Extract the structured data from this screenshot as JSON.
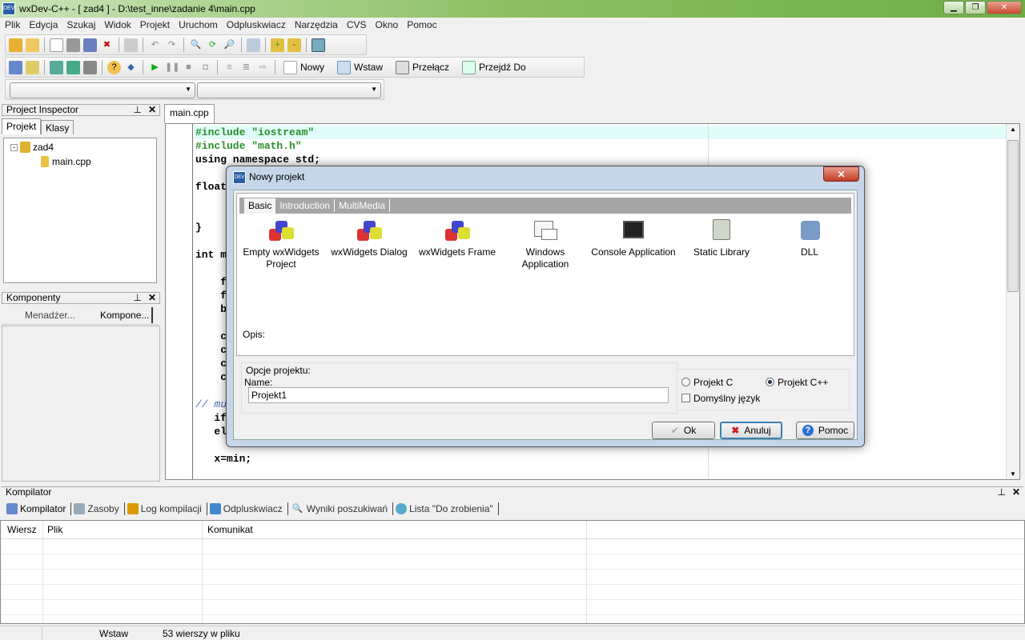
{
  "window": {
    "title": "wxDev-C++  - [ zad4 ] - D:\\test_inne\\zadanie 4\\main.cpp",
    "minimize": "▁",
    "maximize": "❐",
    "close": "✕",
    "logo": "DEV"
  },
  "menu": [
    "Plik",
    "Edycja",
    "Szukaj",
    "Widok",
    "Projekt",
    "Uruchom",
    "Odpluskwiacz",
    "Narzędzia",
    "CVS",
    "Okno",
    "Pomoc"
  ],
  "toolbar2": {
    "new": "Nowy",
    "insert": "Wstaw",
    "toggle": "Przełącz",
    "goto": "Przejdź Do"
  },
  "project_inspector": {
    "title": "Project Inspector",
    "tabs": [
      "Projekt",
      "Klasy"
    ],
    "tree": {
      "root": "zad4",
      "child": "main.cpp"
    }
  },
  "components": {
    "title": "Komponenty",
    "tabs": [
      "Menadżer...",
      "Kompone..."
    ]
  },
  "editor": {
    "tab": "main.cpp",
    "lines": [
      {
        "t": "#include \"iostream\"",
        "c": "pp"
      },
      {
        "t": "#include \"math.h\"",
        "c": "pp"
      },
      {
        "t": "using namespace std;",
        "c": ""
      },
      {
        "t": "",
        "c": ""
      },
      {
        "t": "float",
        "c": ""
      },
      {
        "t": "",
        "c": ""
      },
      {
        "t": "",
        "c": ""
      },
      {
        "t": "}",
        "c": ""
      },
      {
        "t": "",
        "c": ""
      },
      {
        "t": "int m",
        "c": ""
      },
      {
        "t": "",
        "c": ""
      },
      {
        "t": "    f",
        "c": ""
      },
      {
        "t": "    f",
        "c": ""
      },
      {
        "t": "    b",
        "c": ""
      },
      {
        "t": "",
        "c": ""
      },
      {
        "t": "    c",
        "c": ""
      },
      {
        "t": "    c",
        "c": ""
      },
      {
        "t": "    c",
        "c": ""
      },
      {
        "t": "    c",
        "c": ""
      },
      {
        "t": "",
        "c": ""
      },
      {
        "t": "// mu",
        "c": "cm"
      },
      {
        "t": "   if",
        "c": ""
      },
      {
        "t": "   el",
        "c": ""
      },
      {
        "t": "",
        "c": ""
      },
      {
        "t": "   x=min;",
        "c": ""
      }
    ]
  },
  "dialog": {
    "title": "Nowy projekt",
    "close": "✕",
    "tabs": [
      "Basic",
      "Introduction",
      "MultiMedia"
    ],
    "templates": [
      "Empty wxWidgets Project",
      "wxWidgets Dialog",
      "wxWidgets Frame",
      "Windows Application",
      "Console Application",
      "Static Library",
      "DLL"
    ],
    "description_label": "Opis:",
    "options_label": "Opcje projektu:",
    "name_label": "Name:",
    "name_value": "Projekt1",
    "radio_c": "Projekt C",
    "radio_cpp": "Projekt C++",
    "selected_language": "Projekt C++",
    "default_lang": "Domyślny język",
    "default_lang_checked": false,
    "ok": "Ok",
    "cancel": "Anuluj",
    "help": "Pomoc"
  },
  "compiler": {
    "title": "Kompilator",
    "tabs": [
      "Kompilator",
      "Zasoby",
      "Log kompilacji",
      "Odpluskwiacz",
      "Wyniki poszukiwań",
      "Lista \"Do zrobienia\""
    ],
    "columns": [
      "Wiersz",
      "Plik",
      "Komunikat"
    ]
  },
  "status": {
    "mode": "Wstaw",
    "lines": "53 wierszy w pliku"
  }
}
